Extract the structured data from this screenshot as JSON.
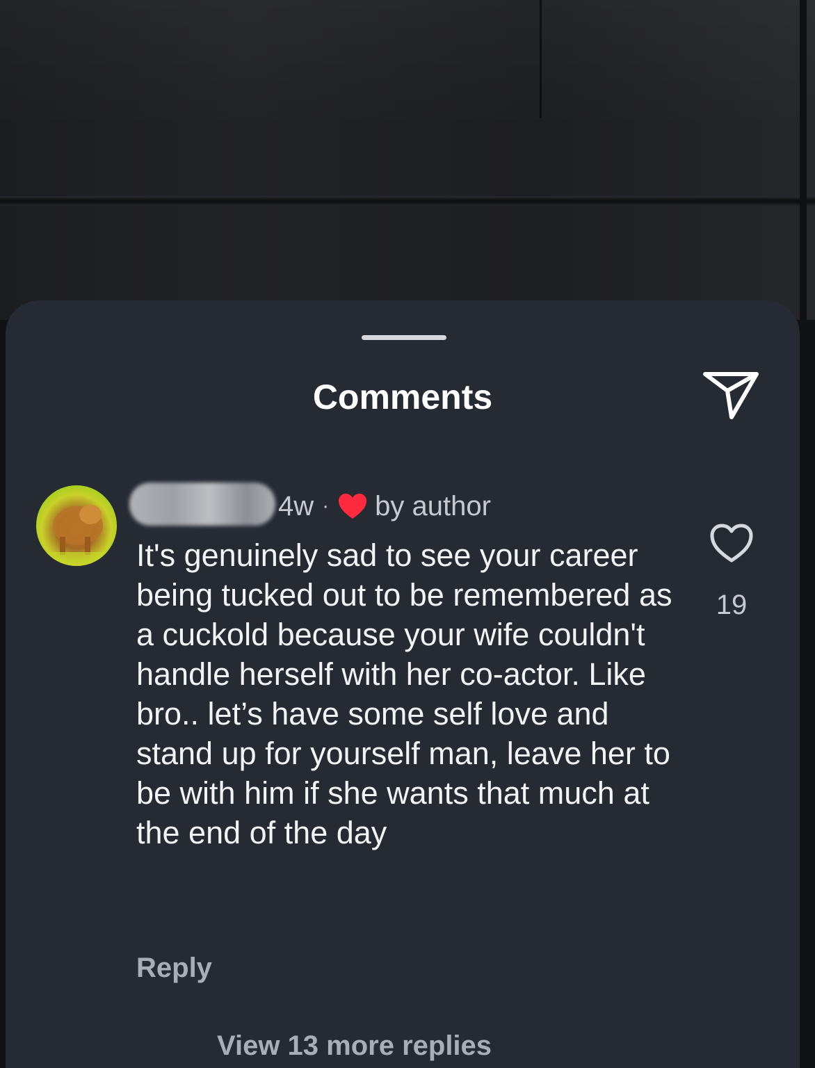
{
  "sheet": {
    "title": "Comments"
  },
  "comment": {
    "time": "4w",
    "separator": "·",
    "liked_by": "by author",
    "text": "It's genuinely sad to see your career being tucked out to be remembered as a cuckold because your wife couldn't handle herself with her co-actor. Like bro.. let’s have some self love and stand up for yourself man, leave her to be with him if she wants that much at the end of the day",
    "reply_label": "Reply",
    "like_count": "19"
  },
  "replies": {
    "view_more_label": "View 13 more replies"
  },
  "colors": {
    "sheet_bg": "#262a33",
    "author_heart": "#ff2a3d",
    "text_primary": "#f2f3f5",
    "text_secondary": "#a9adb5"
  },
  "icons": {
    "share": "paper-plane-icon",
    "like": "heart-outline-icon",
    "liked_by_author": "heart-filled-icon"
  }
}
